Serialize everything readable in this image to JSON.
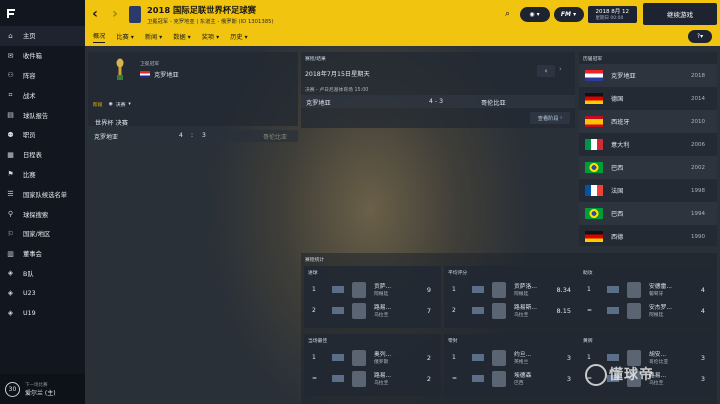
{
  "sidebar": {
    "items": [
      {
        "label": "主页",
        "icon": "home-icon"
      },
      {
        "label": "收件箱",
        "icon": "inbox-icon"
      },
      {
        "label": "阵容",
        "icon": "squad-icon"
      },
      {
        "label": "战术",
        "icon": "tactics-icon"
      },
      {
        "label": "球队报告",
        "icon": "report-icon"
      },
      {
        "label": "职员",
        "icon": "staff-icon"
      },
      {
        "label": "日程表",
        "icon": "calendar-icon"
      },
      {
        "label": "比赛",
        "icon": "match-icon"
      },
      {
        "label": "国家队候选名单",
        "icon": "shortlist-icon"
      },
      {
        "label": "球探搜索",
        "icon": "scouting-icon"
      },
      {
        "label": "国家/地区",
        "icon": "nation-icon"
      },
      {
        "label": "董事会",
        "icon": "board-icon"
      },
      {
        "label": "B队",
        "icon": "b-team-icon"
      },
      {
        "label": "U23",
        "icon": "u23-icon"
      },
      {
        "label": "U19",
        "icon": "u19-icon"
      }
    ],
    "bottom": {
      "badge": "30",
      "line1": "下一场比赛",
      "line2": "爱尔兰 (主)"
    }
  },
  "header": {
    "title": "2018 国际足联世界杯足球赛",
    "subtitle": "卫冕冠军 - 克罗地亚 | 东道主 - 俄罗斯 (ID 1301385)",
    "date_line1": "2018 8月 12",
    "date_line2": "星期日 00:00",
    "continue_label": "继续游戏",
    "help_label": "?",
    "tabs": [
      "概况",
      "比赛",
      "新闻",
      "数据",
      "奖项",
      "历史"
    ]
  },
  "champion": {
    "label": "卫冕冠军",
    "name": "克罗地亚"
  },
  "stage": {
    "label": "阶段",
    "select": "决赛",
    "round": "世界杯 决赛",
    "home": "克罗地亚",
    "score_home": "4",
    "sep": ":",
    "score_away": "3",
    "away": "哥伦比亚"
  },
  "last_match": {
    "title": "赛程/结果",
    "date": "2018年7月15日星期天",
    "meta": "决赛 - 卢日尼基体育场 15:00",
    "home": "克罗地亚",
    "score": "4 - 3",
    "away": "哥伦比亚",
    "button": "查看阶段"
  },
  "past_winners": {
    "title": "历届冠军",
    "items": [
      {
        "team": "克罗地亚",
        "year": "2018",
        "flag": "hr"
      },
      {
        "team": "德国",
        "year": "2014",
        "flag": "de"
      },
      {
        "team": "西班牙",
        "year": "2010",
        "flag": "es"
      },
      {
        "team": "意大利",
        "year": "2006",
        "flag": "it"
      },
      {
        "team": "巴西",
        "year": "2002",
        "flag": "br"
      },
      {
        "team": "法国",
        "year": "1998",
        "flag": "fr"
      },
      {
        "team": "巴西",
        "year": "1994",
        "flag": "br"
      },
      {
        "team": "西德",
        "year": "1990",
        "flag": "de"
      }
    ]
  },
  "stats_title": "赛程统计",
  "stat_cards": [
    {
      "title": "进球",
      "rows": [
        {
          "rank": "1",
          "name": "贡萨...",
          "team": "阿根廷",
          "value": "9"
        },
        {
          "rank": "2",
          "name": "路易...",
          "team": "乌拉圭",
          "value": "7"
        }
      ]
    },
    {
      "title": "平均评分",
      "rows": [
        {
          "rank": "1",
          "name": "贡萨洛...",
          "team": "阿根廷",
          "value": "8.34"
        },
        {
          "rank": "2",
          "name": "路易斯...",
          "team": "乌拉圭",
          "value": "8.15"
        }
      ]
    },
    {
      "title": "助攻",
      "rows": [
        {
          "rank": "1",
          "name": "安德雷...",
          "team": "葡萄牙",
          "value": "4"
        },
        {
          "rank": "=",
          "name": "安杰罗...",
          "team": "阿根廷",
          "value": "4"
        }
      ]
    },
    {
      "title": "当场最佳",
      "rows": [
        {
          "rank": "1",
          "name": "奥列...",
          "team": "俄罗斯",
          "value": "2"
        },
        {
          "rank": "=",
          "name": "路易...",
          "team": "乌拉圭",
          "value": "2"
        }
      ]
    },
    {
      "title": "零封",
      "rows": [
        {
          "rank": "1",
          "name": "约旦...",
          "team": "英格兰",
          "value": "3"
        },
        {
          "rank": "=",
          "name": "埃德森",
          "team": "巴西",
          "value": "3"
        }
      ]
    },
    {
      "title": "黄牌",
      "rows": [
        {
          "rank": "1",
          "name": "胡安...",
          "team": "哥伦比亚",
          "value": "3"
        },
        {
          "rank": "=",
          "name": "路易...",
          "team": "乌拉圭",
          "value": "3"
        }
      ]
    }
  ],
  "watermark": "懂球帝"
}
